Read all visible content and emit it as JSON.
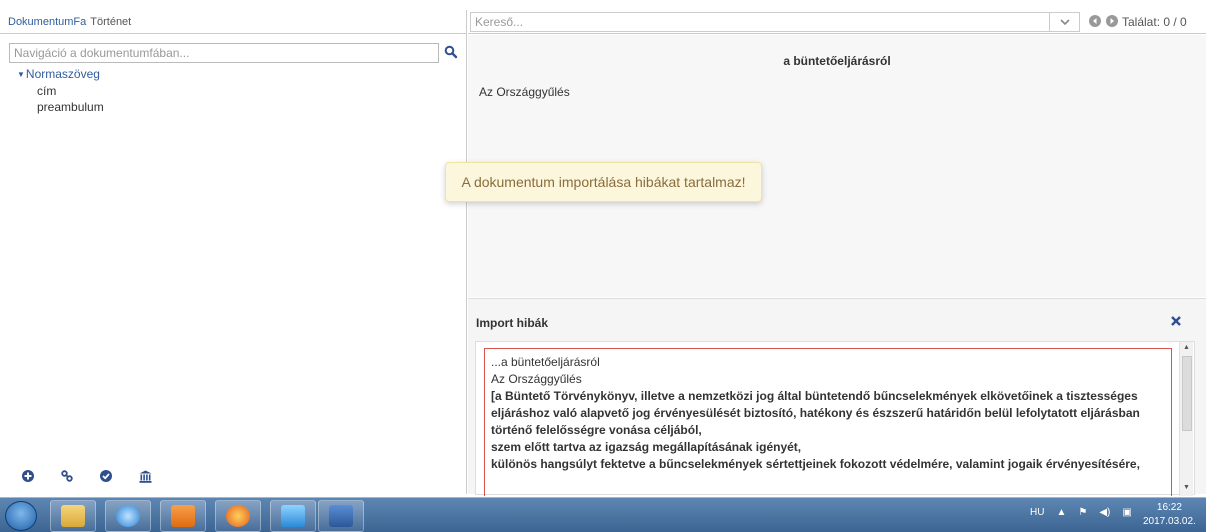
{
  "left_panel": {
    "tabs": [
      {
        "label": "DokumentumFa"
      },
      {
        "label": "Történet"
      }
    ],
    "search_placeholder": "Navigáció a dokumentumfában...",
    "tree": {
      "root": "Normaszöveg",
      "children": [
        "cím",
        "preambulum"
      ]
    },
    "tools": [
      "plus-circle-icon",
      "link-icon",
      "check-circle-icon",
      "institution-icon"
    ]
  },
  "right_panel": {
    "search_placeholder": "Kereső...",
    "hits_label": "Találat: 0 / 0",
    "document": {
      "title": "a büntetőeljárásról",
      "body": "Az Országgyűlés"
    },
    "toast": "A dokumentum importálása hibákat tartalmaz!",
    "import_errors": {
      "title": "Import hibák",
      "lines": [
        {
          "text": "...a büntetőeljárásról",
          "bold": false
        },
        {
          "text": "Az Országgyűlés",
          "bold": false
        },
        {
          "text": "[a Büntető Törvénykönyv, illetve a nemzetközi jog által büntetendő bűncselekmények elkövetőinek a tisztességes",
          "bold": true
        },
        {
          "text": "eljáráshoz való alapvető jog érvényesülését biztosító, hatékony és észszerű határidőn belül lefolytatott eljárásban",
          "bold": true
        },
        {
          "text": "történő felelősségre vonása céljából,",
          "bold": true
        },
        {
          "text": "szem előtt tartva az igazság megállapításának igényét,",
          "bold": true
        },
        {
          "text": "különös hangsúlyt fektetve a bűncselekmények sértettjeinek fokozott védelmére, valamint jogaik érvényesítésére,",
          "bold": true
        }
      ]
    }
  },
  "taskbar": {
    "language": "HU",
    "time": "16:22",
    "date": "2017.03.02."
  }
}
